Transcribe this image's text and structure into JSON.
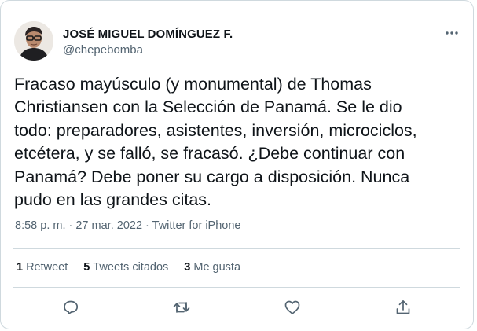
{
  "author": {
    "display_name": "JOSÉ MIGUEL DOMÍNGUEZ F.",
    "handle": "@chepebomba"
  },
  "tweet": {
    "text": "Fracaso mayúsculo (y monumental) de Thomas\nChristiansen con la Selección de Panamá. Se le dio\ntodo: preparadores, asistentes, inversión, microciclos,\netcétera, y se falló, se fracasó. ¿Debe continuar con\nPanamá? Debe poner su cargo a disposición. Nunca\npudo en las grandes citas.",
    "timestamp": "8:58 p. m. · 27 mar. 2022 ·",
    "source": "Twitter for iPhone"
  },
  "stats": {
    "retweets_count": "1",
    "retweets_label": "Retweet",
    "quotes_count": "5",
    "quotes_label": "Tweets citados",
    "likes_count": "3",
    "likes_label": "Me gusta"
  },
  "icons": {
    "more": "more-horizontal-icon",
    "reply": "reply-icon",
    "retweet": "retweet-icon",
    "like": "heart-icon",
    "share": "share-icon"
  },
  "colors": {
    "text": "#0f1419",
    "secondary": "#536471",
    "border": "#cfd9de"
  }
}
